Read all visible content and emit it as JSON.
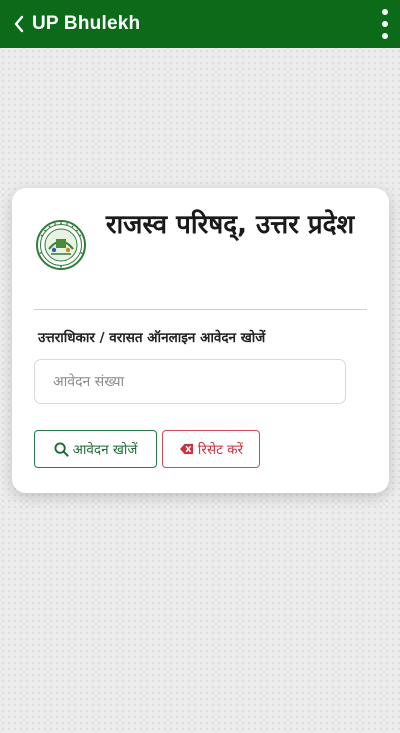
{
  "appbar": {
    "title": "UP Bhulekh",
    "back_icon": "chevron-left-icon",
    "menu_icon": "more-vert-icon",
    "color": "#0c6b19"
  },
  "card": {
    "logo": "up-revenue-board-seal",
    "title": "राजस्व परिषद्, उत्तर प्रदेश",
    "subtitle": "उत्तराधिकार / वरासत ऑनलाइन आवेदन खोजें",
    "input": {
      "placeholder": "आवेदन संख्या",
      "value": ""
    },
    "search_button": {
      "label": "आवेदन खोजें",
      "icon": "search-icon",
      "color": "#1f6b3a"
    },
    "reset_button": {
      "label": "रिसेट करें",
      "icon": "eraser-icon",
      "color": "#c9323f"
    }
  }
}
